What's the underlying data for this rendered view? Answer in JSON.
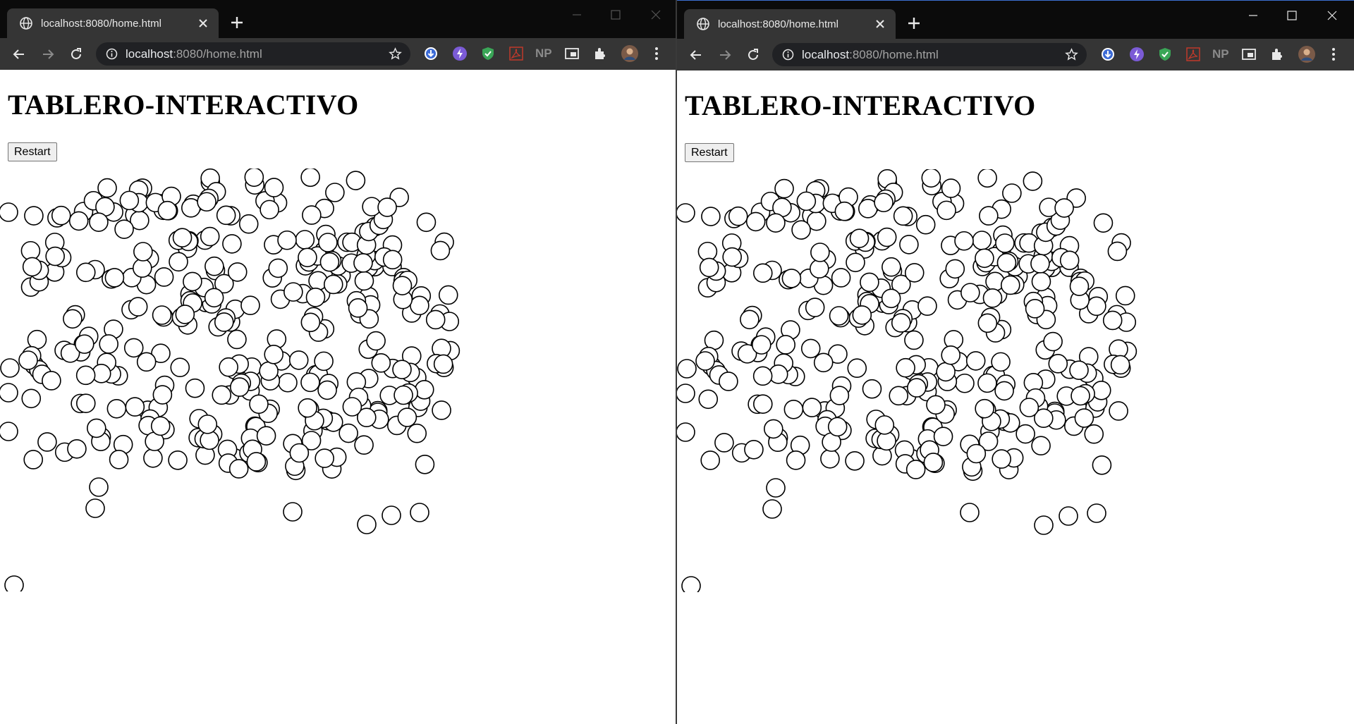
{
  "windows": [
    {
      "tab": {
        "title": "localhost:8080/home.html"
      },
      "omnibox": {
        "host": "localhost",
        "rest": ":8080/home.html"
      },
      "page": {
        "heading": "TABLERO-INTERACTIVO",
        "restart_label": "Restart"
      }
    },
    {
      "tab": {
        "title": "localhost:8080/home.html"
      },
      "omnibox": {
        "host": "localhost",
        "rest": ":8080/home.html"
      },
      "page": {
        "heading": "TABLERO-INTERACTIVO",
        "restart_label": "Restart"
      }
    }
  ],
  "extensions": [
    "download-extension-icon",
    "bolt-extension-icon",
    "shield-extension-icon",
    "pdf-extension-icon",
    "np-extension-icon",
    "picture-in-picture-icon",
    "puzzle-extensions-icon",
    "profile-avatar"
  ],
  "extension_np_label": "NP",
  "colors": {
    "titlebar": "#0b0b0b",
    "toolbar": "#353535",
    "omnibox": "#202124",
    "circle_stroke": "#000000",
    "circle_fill": "#ffffff"
  }
}
